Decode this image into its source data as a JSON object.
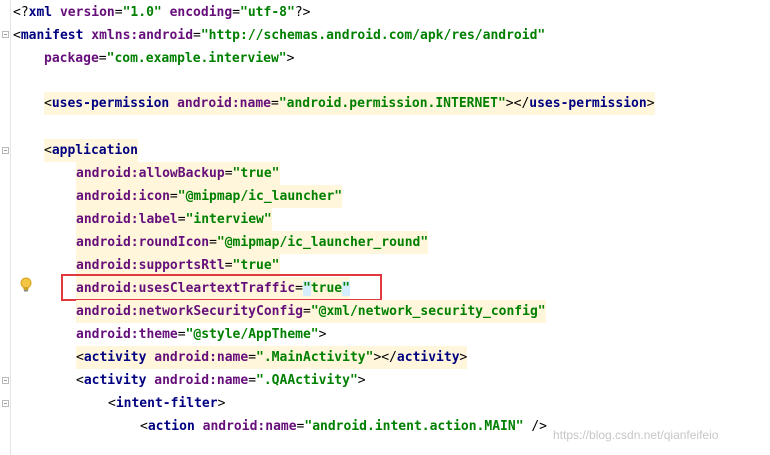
{
  "editor": {
    "lines": {
      "l1": {
        "open": "<?",
        "tag": "xml",
        "a1": "version",
        "v1": "\"1.0\"",
        "a2": "encoding",
        "v2": "\"utf-8\"",
        "close": "?>"
      },
      "l2": {
        "open": "<",
        "tag": "manifest",
        "attr": "xmlns:android",
        "eq": "=",
        "val": "\"http://schemas.android.com/apk/res/android\""
      },
      "l3": {
        "attr": "package",
        "eq": "=",
        "val": "\"com.example.interview\"",
        "close": ">"
      },
      "l4": {
        "open": "<",
        "tag": "uses-permission",
        "attr": "android:name",
        "eq": "=",
        "val": "\"android.permission.INTERNET\"",
        "mid": "></",
        "tag2": "uses-permission",
        "close": ">"
      },
      "l5": {
        "open": "<",
        "tag": "application"
      },
      "l6": {
        "attr": "android:allowBackup",
        "eq": "=",
        "val": "\"true\""
      },
      "l7": {
        "attr": "android:icon",
        "eq": "=",
        "val": "\"@mipmap/ic_launcher\""
      },
      "l8": {
        "attr": "android:label",
        "eq": "=",
        "val": "\"interview\""
      },
      "l9": {
        "attr": "android:roundIcon",
        "eq": "=",
        "val": "\"@mipmap/ic_launcher_round\""
      },
      "l10": {
        "attr": "android:supportsRtl",
        "eq": "=",
        "val": "\"true\""
      },
      "l11": {
        "attr": "android:usesCleartextTraffic",
        "eq": "=",
        "q1": "\"",
        "val": "true",
        "q2": "\""
      },
      "l12": {
        "attr": "android:networkSecurityConfig",
        "eq": "=",
        "val": "\"@xml/network_security_config\""
      },
      "l13": {
        "attr": "android:theme",
        "eq": "=",
        "val": "\"@style/AppTheme\"",
        "close": ">"
      },
      "l14": {
        "open": "<",
        "tag": "activity",
        "attr": "android:name",
        "eq": "=",
        "val": "\".MainActivity\"",
        "mid": "></",
        "tag2": "activity",
        "close": ">"
      },
      "l15": {
        "open": "<",
        "tag": "activity",
        "attr": "android:name",
        "eq": "=",
        "val": "\".QAActivity\"",
        "close": ">"
      },
      "l16": {
        "open": "<",
        "tag": "intent-filter",
        "close": ">"
      },
      "l17": {
        "open": "<",
        "tag": "action",
        "attr": "android:name",
        "eq": "=",
        "val": "\"android.intent.action.MAIN\"",
        "close": " />"
      }
    },
    "colors": {
      "tag": "#000080",
      "attribute": "#660e7a",
      "value": "#008000",
      "highlight_box": "#e0393e",
      "line_highlight": "#fff6db"
    },
    "intention_icon": "lightbulb-icon"
  },
  "watermark": {
    "text": "https://blog.csdn.net/qianfeifeio"
  }
}
